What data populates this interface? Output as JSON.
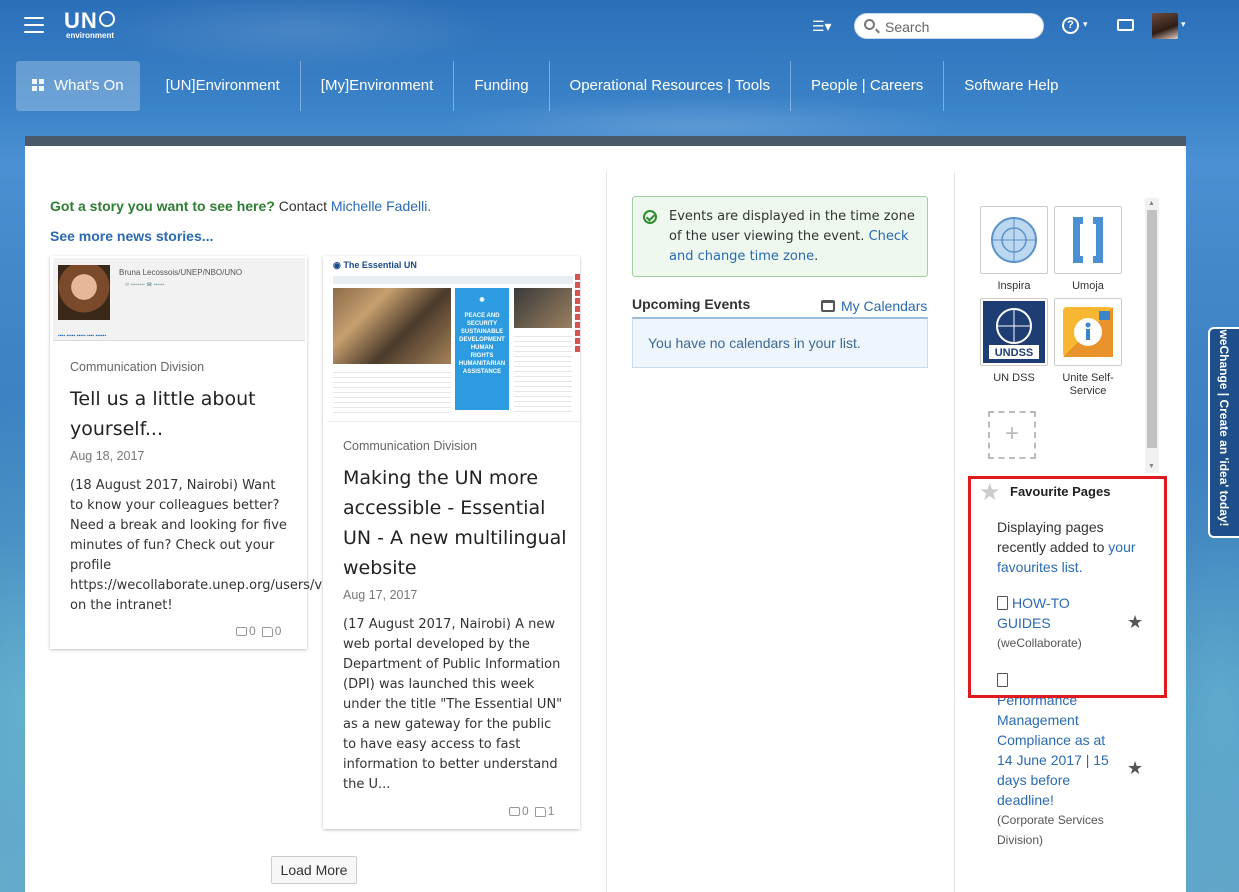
{
  "brand": {
    "logo_text": "UN",
    "logo_sub": "environment"
  },
  "search": {
    "placeholder": "Search"
  },
  "nav": {
    "items": [
      {
        "label": "What's On"
      },
      {
        "label": "[UN]Environment"
      },
      {
        "label": "[My]Environment"
      },
      {
        "label": "Funding"
      },
      {
        "label": "Operational Resources | Tools"
      },
      {
        "label": "People | Careers"
      },
      {
        "label": "Software Help"
      }
    ]
  },
  "news": {
    "story_prompt": "Got a story you want to see here?",
    "contact_text": "Contact",
    "contact_name": "Michelle Fadelli.",
    "see_more": "See more news stories...",
    "load_more": "Load More",
    "cards": [
      {
        "division": "Communication Division",
        "title": "Tell us a little about yourself...",
        "date": "Aug 18, 2017",
        "body": "(18 August 2017, Nairobi) Want to know your colleagues better? Need a break and looking for five minutes of fun? Check out your profile https://wecollaborate.unep.org/users/viewmyprofile.action on the intranet!",
        "comments": "0",
        "likes": "0",
        "thumb_name": "Bruna Lecossois/UNEP/NBO/UNO"
      },
      {
        "division": "Communication Division",
        "title": "Making the UN more accessible - Essential UN - A new multilingual website",
        "date": "Aug 17, 2017",
        "body": "(17 August 2017, Nairobi) A new web portal developed by the Department of Public Information (DPI) was launched this week under the title \"The Essential UN\" as a new gateway for the public to have easy access to fast information to better understand the U...",
        "comments": "0",
        "likes": "1",
        "thumb_name": "The Essential UN"
      }
    ]
  },
  "events": {
    "timezone_notice": "Events are displayed in the time zone of the user viewing the event.",
    "timezone_link": "Check and change time zone",
    "upcoming_label": "Upcoming Events",
    "my_calendars": "My Calendars",
    "empty_text": "You have no calendars in your list."
  },
  "apps": [
    {
      "name": "Inspira",
      "icon": "un-emblem-icon"
    },
    {
      "name": "Umoja",
      "icon": "bracket-icon"
    },
    {
      "name": "UN DSS",
      "icon": "undss-icon"
    },
    {
      "name": "Unite Self-Service",
      "icon": "info-icon"
    }
  ],
  "favourites": {
    "title": "Favourite Pages",
    "desc_prefix": "Displaying pages recently added to",
    "desc_link": "your favourites list.",
    "items": [
      {
        "title": "HOW-TO GUIDES",
        "source": "(weCollaborate)"
      },
      {
        "title": "Performance Management Compliance as at 14 June 2017 | 15 days before deadline!",
        "source": "(Corporate Services Division)"
      }
    ]
  },
  "side_tab": "weChange | Create an 'idea' today!",
  "colors": {
    "accent": "#2a6ab3",
    "highlight": "#e0191e",
    "success": "#2e7d32"
  }
}
